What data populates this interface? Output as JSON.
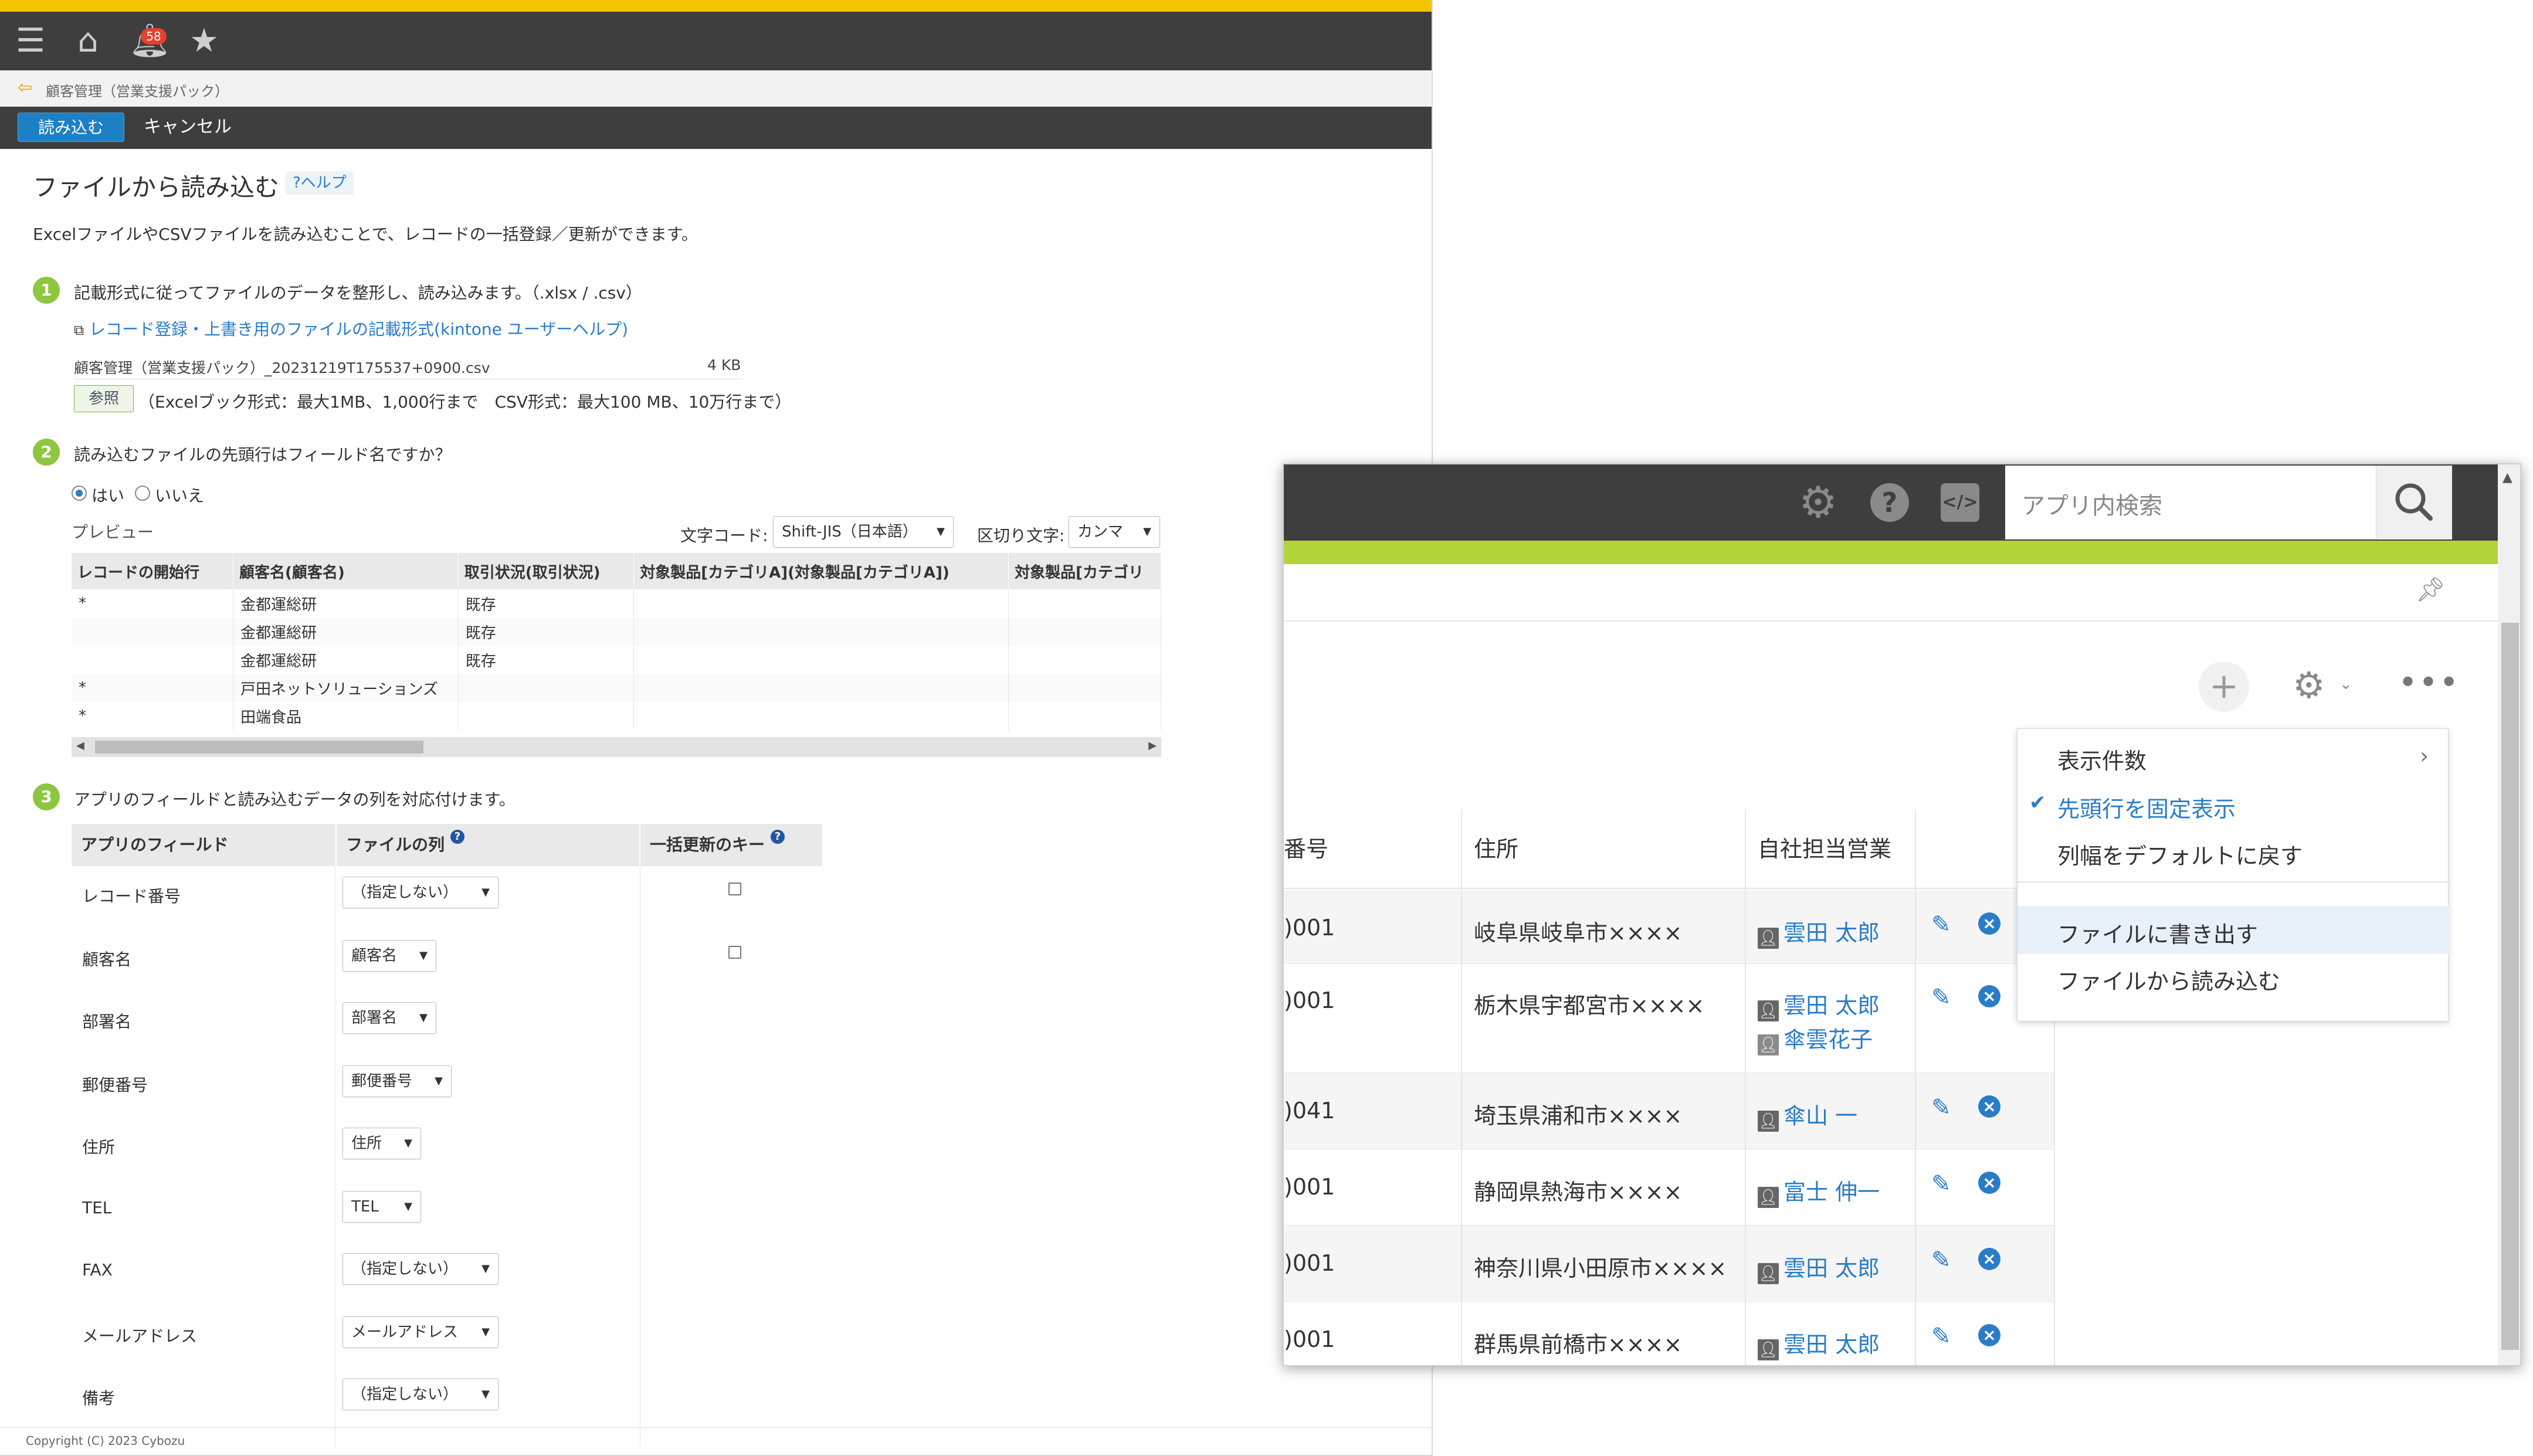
{
  "left": {
    "notification_count": "58",
    "breadcrumb": "顧客管理（営業支援パック）",
    "actions": {
      "load": "読み込む",
      "cancel": "キャンセル"
    },
    "title": "ファイルから読み込む",
    "help": "?ヘルプ",
    "description": "ExcelファイルやCSVファイルを読み込むことで、レコードの一括登録／更新ができます。",
    "step1": {
      "num": "1",
      "text": "記載形式に従ってファイルのデータを整形し、読み込みます。（.xlsx / .csv）",
      "link": "レコード登録・上書き用のファイルの記載形式(kintone ユーザーヘルプ)",
      "file_name": "顧客管理（営業支援パック）_20231219T175537+0900.csv",
      "file_size": "4 KB",
      "browse": "参照",
      "limits": "（Excelブック形式：最大1MB、1,000行まで　CSV形式：最大100 MB、10万行まで）"
    },
    "step2": {
      "num": "2",
      "text": "読み込むファイルの先頭行はフィールド名ですか？",
      "yes": "はい",
      "no": "いいえ",
      "preview_label": "プレビュー",
      "encoding_label": "文字コード:",
      "encoding_value": "Shift-JIS（日本語）",
      "delimiter_label": "区切り文字:",
      "delimiter_value": "カンマ",
      "columns": [
        "レコードの開始行",
        "顧客名(顧客名)",
        "取引状況(取引状況)",
        "対象製品[カテゴリA](対象製品[カテゴリA])",
        "対象製品[カテゴリ"
      ],
      "rows": [
        [
          "*",
          "金都運総研",
          "既存",
          "",
          ""
        ],
        [
          "",
          "金都運総研",
          "既存",
          "",
          ""
        ],
        [
          "",
          "金都運総研",
          "既存",
          "",
          ""
        ],
        [
          "*",
          "戸田ネットソリューションズ",
          "",
          "",
          ""
        ],
        [
          "*",
          "田端食品",
          "",
          "",
          ""
        ]
      ]
    },
    "step3": {
      "num": "3",
      "text": "アプリのフィールドと読み込むデータの列を対応付けます。",
      "headers": {
        "app_field": "アプリのフィールド",
        "file_column": "ファイルの列",
        "bulk_key": "一括更新のキー"
      },
      "rows": [
        {
          "field": "レコード番号",
          "column": "（指定しない）",
          "key": true
        },
        {
          "field": "顧客名",
          "column": "顧客名",
          "key": true
        },
        {
          "field": "部署名",
          "column": "部署名",
          "key": false
        },
        {
          "field": "郵便番号",
          "column": "郵便番号",
          "key": false
        },
        {
          "field": "住所",
          "column": "住所",
          "key": false
        },
        {
          "field": "TEL",
          "column": "TEL",
          "key": false
        },
        {
          "field": "FAX",
          "column": "（指定しない）",
          "key": false
        },
        {
          "field": "メールアドレス",
          "column": "メールアドレス",
          "key": false
        },
        {
          "field": "備考",
          "column": "（指定しない）",
          "key": false
        }
      ]
    },
    "copyright": "Copyright (C) 2023 Cybozu"
  },
  "right": {
    "search_placeholder": "アプリ内検索",
    "columns": {
      "number": "番号",
      "address": "住所",
      "sales": "自社担当営業"
    },
    "records": [
      {
        "number": ")001",
        "address": "岐阜県岐阜市××××",
        "users": [
          "雲田 太郎"
        ]
      },
      {
        "number": ")001",
        "address": "栃木県宇都宮市××××",
        "users": [
          "雲田 太郎",
          "傘雲花子"
        ]
      },
      {
        "number": ")041",
        "address": "埼玉県浦和市××××",
        "users": [
          "傘山 一"
        ]
      },
      {
        "number": ")001",
        "address": "静岡県熱海市××××",
        "users": [
          "富士 伸一"
        ]
      },
      {
        "number": ")001",
        "address": "神奈川県小田原市××××",
        "users": [
          "雲田 太郎"
        ]
      },
      {
        "number": ")001",
        "address": "群馬県前橋市××××",
        "users": [
          "雲田 太郎"
        ]
      }
    ],
    "menu": {
      "items": [
        "表示件数",
        "先頭行を固定表示",
        "列幅をデフォルトに戻す",
        "ファイルに書き出す",
        "ファイルから読み込む"
      ]
    }
  },
  "colors": {
    "accent": "#2a7cc7",
    "topbar": "#3e3e3e",
    "yellow": "#f4c400",
    "green": "#b3d43b",
    "step": "#8dc63f"
  }
}
